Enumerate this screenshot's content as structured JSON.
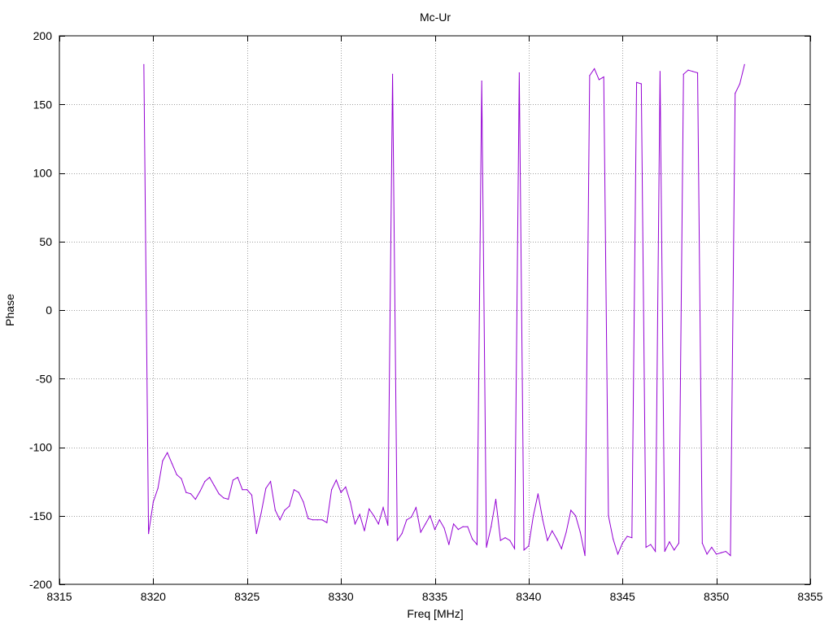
{
  "chart_data": {
    "type": "line",
    "title": "Mc-Ur",
    "xlabel": "Freq [MHz]",
    "ylabel": "Phase",
    "xlim": [
      8315,
      8355
    ],
    "ylim": [
      -200,
      200
    ],
    "xticks": [
      8315,
      8320,
      8325,
      8330,
      8335,
      8340,
      8345,
      8350,
      8355
    ],
    "yticks": [
      -200,
      -150,
      -100,
      -50,
      0,
      50,
      100,
      150,
      200
    ],
    "grid": true,
    "series": [
      {
        "color": "#9400d3",
        "x": [
          8319.5,
          8319.75,
          8320.0,
          8320.25,
          8320.5,
          8320.75,
          8321.0,
          8321.25,
          8321.5,
          8321.75,
          8322.0,
          8322.25,
          8322.5,
          8322.75,
          8323.0,
          8323.25,
          8323.5,
          8323.75,
          8324.0,
          8324.25,
          8324.5,
          8324.75,
          8325.0,
          8325.25,
          8325.5,
          8325.75,
          8326.0,
          8326.25,
          8326.5,
          8326.75,
          8327.0,
          8327.25,
          8327.5,
          8327.75,
          8328.0,
          8328.25,
          8328.5,
          8328.75,
          8329.0,
          8329.25,
          8329.5,
          8329.75,
          8330.0,
          8330.25,
          8330.5,
          8330.75,
          8331.0,
          8331.25,
          8331.5,
          8331.75,
          8332.0,
          8332.25,
          8332.5,
          8332.75,
          8333.0,
          8333.25,
          8333.5,
          8333.75,
          8334.0,
          8334.25,
          8334.5,
          8334.75,
          8335.0,
          8335.25,
          8335.5,
          8335.75,
          8336.0,
          8336.25,
          8336.5,
          8336.75,
          8337.0,
          8337.25,
          8337.5,
          8337.75,
          8338.0,
          8338.25,
          8338.5,
          8338.75,
          8339.0,
          8339.25,
          8339.5,
          8339.75,
          8340.0,
          8340.25,
          8340.5,
          8340.75,
          8341.0,
          8341.25,
          8341.5,
          8341.75,
          8342.0,
          8342.25,
          8342.5,
          8342.75,
          8343.0,
          8343.25,
          8343.5,
          8343.75,
          8344.0,
          8344.25,
          8344.5,
          8344.75,
          8345.0,
          8345.25,
          8345.5,
          8345.75,
          8346.0,
          8346.25,
          8346.5,
          8346.75,
          8347.0,
          8347.25,
          8347.5,
          8347.75,
          8348.0,
          8348.25,
          8348.5,
          8348.75,
          8349.0,
          8349.25,
          8349.5,
          8349.75,
          8350.0,
          8350.25,
          8350.5,
          8350.75,
          8351.0,
          8351.25,
          8351.5
        ],
        "y": [
          179,
          -163,
          -140,
          -130,
          -110,
          -104,
          -112,
          -120,
          -123,
          -133,
          -134,
          -138,
          -132,
          -125,
          -122,
          -128,
          -134,
          -137,
          -138,
          -124,
          -122,
          -131,
          -131,
          -135,
          -163,
          -148,
          -130,
          -125,
          -146,
          -153,
          -146,
          -143,
          -131,
          -133,
          -140,
          -152,
          -153,
          -153,
          -153,
          -155,
          -131,
          -124,
          -133,
          -129,
          -140,
          -156,
          -149,
          -161,
          -145,
          -150,
          -156,
          -144,
          -157,
          172,
          -168,
          -163,
          -153,
          -151,
          -144,
          -162,
          -156,
          -150,
          -160,
          -153,
          -159,
          -171,
          -156,
          -160,
          -158,
          -158,
          -167,
          -171,
          167,
          -173,
          -158,
          -138,
          -168,
          -166,
          -168,
          -174,
          173,
          -175,
          -172,
          -150,
          -134,
          -153,
          -168,
          -161,
          -167,
          -174,
          -162,
          -146,
          -150,
          -162,
          -179,
          171,
          176,
          168,
          170,
          -150,
          -167,
          -178,
          -170,
          -165,
          -166,
          166,
          165,
          -173,
          -171,
          -176,
          174,
          -176,
          -169,
          -175,
          -170,
          172,
          175,
          174,
          173,
          -170,
          -178,
          -173,
          -178,
          -177,
          -176,
          -179,
          158,
          165,
          179
        ]
      }
    ]
  }
}
